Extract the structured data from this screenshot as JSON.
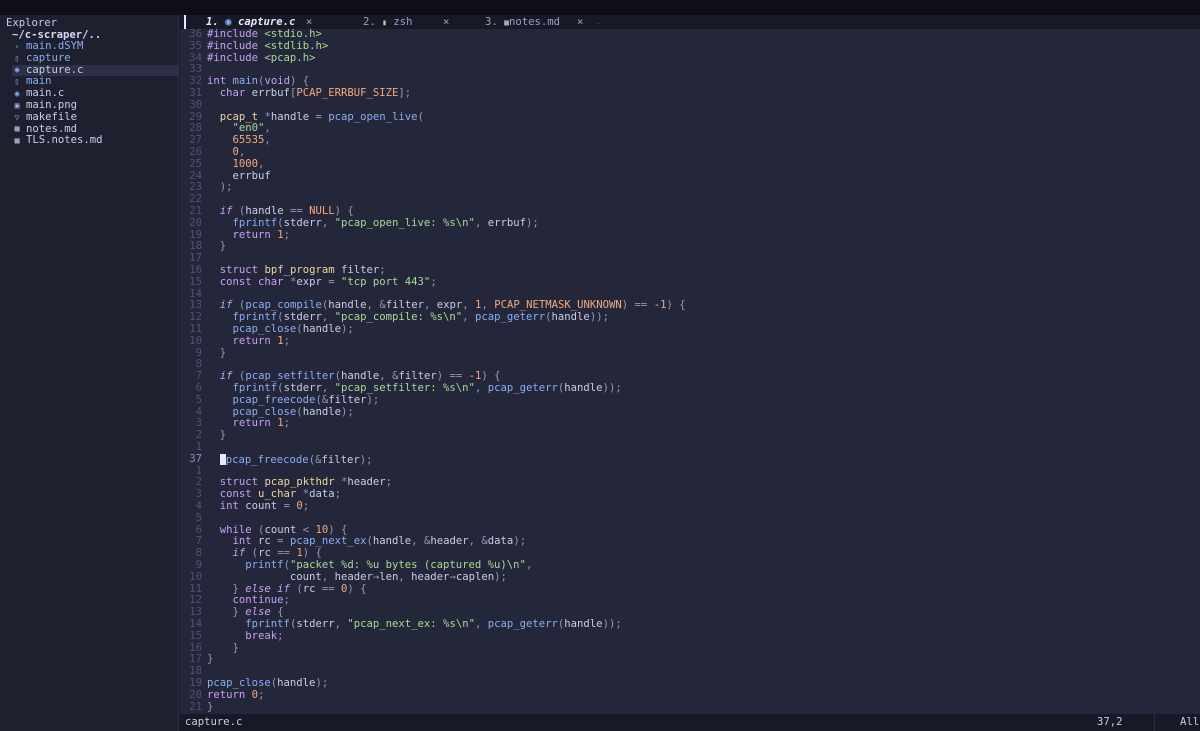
{
  "sidebar": {
    "title": "Explorer",
    "root": "~/c-scraper/..",
    "items": [
      {
        "name": "main.dSYM",
        "icon": "folder-chevron-icon",
        "kind": "dir",
        "selected": false
      },
      {
        "name": "capture",
        "icon": "file-icon",
        "kind": "exe",
        "selected": false
      },
      {
        "name": "capture.c",
        "icon": "c-file-icon",
        "kind": "file",
        "selected": true
      },
      {
        "name": "main",
        "icon": "file-icon",
        "kind": "exe",
        "selected": false
      },
      {
        "name": "main.c",
        "icon": "c-file-icon",
        "kind": "file",
        "selected": false
      },
      {
        "name": "main.png",
        "icon": "image-file-icon",
        "kind": "file",
        "selected": false
      },
      {
        "name": "makefile",
        "icon": "makefile-icon",
        "kind": "file",
        "selected": false
      },
      {
        "name": "notes.md",
        "icon": "markdown-file-icon",
        "kind": "file",
        "selected": false
      },
      {
        "name": "TLS.notes.md",
        "icon": "markdown-file-icon",
        "kind": "file",
        "selected": false
      }
    ]
  },
  "tabs": [
    {
      "index": "1.",
      "icon": "c-file-icon",
      "label": "capture.c",
      "close": "×",
      "active": true
    },
    {
      "index": "2.",
      "icon": "terminal-icon",
      "label": "zsh",
      "close": "×",
      "active": false
    },
    {
      "index": "3.",
      "icon": "markdown-file-icon",
      "label": "notes.md",
      "close": "×",
      "active": false
    }
  ],
  "tabs_overflow": "‥",
  "editor": {
    "lines": [
      {
        "ln": "36",
        "html": "<span class=\"k\">#include</span> <span class=\"s\">&lt;stdio.h&gt;</span>"
      },
      {
        "ln": "35",
        "html": "<span class=\"k\">#include</span> <span class=\"s\">&lt;stdlib.h&gt;</span>"
      },
      {
        "ln": "34",
        "html": "<span class=\"k\">#include</span> <span class=\"s\">&lt;pcap.h&gt;</span>"
      },
      {
        "ln": "33",
        "html": ""
      },
      {
        "ln": "32",
        "html": "<span class=\"k\">int</span> <span class=\"f\">main</span><span class=\"p\">(</span><span class=\"k\">void</span><span class=\"p\">) {</span>"
      },
      {
        "ln": "31",
        "html": "  <span class=\"k\">char</span> errbuf<span class=\"p\">[</span><span class=\"n\">PCAP_ERRBUF_SIZE</span><span class=\"p\">];</span>"
      },
      {
        "ln": "30",
        "html": ""
      },
      {
        "ln": "29",
        "html": "  <span class=\"t\">pcap_t</span> <span class=\"p\">*</span>handle <span class=\"p\">=</span> <span class=\"f\">pcap_open_live</span><span class=\"p\">(</span>"
      },
      {
        "ln": "28",
        "html": "    <span class=\"s\">\"en0\"</span><span class=\"p\">,</span>"
      },
      {
        "ln": "27",
        "html": "    <span class=\"n\">65535</span><span class=\"p\">,</span>"
      },
      {
        "ln": "26",
        "html": "    <span class=\"n\">0</span><span class=\"p\">,</span>"
      },
      {
        "ln": "25",
        "html": "    <span class=\"n\">1000</span><span class=\"p\">,</span>"
      },
      {
        "ln": "24",
        "html": "    errbuf"
      },
      {
        "ln": "23",
        "html": "  <span class=\"p\">);</span>"
      },
      {
        "ln": "22",
        "html": ""
      },
      {
        "ln": "21",
        "html": "  <span class=\"ki\">if</span> <span class=\"p\">(</span>handle <span class=\"p\">==</span> <span class=\"n\">NULL</span><span class=\"p\">) {</span>"
      },
      {
        "ln": "20",
        "html": "    <span class=\"f\">fprintf</span><span class=\"p\">(</span>stderr<span class=\"p\">,</span> <span class=\"s\">\"pcap_open_live: %s\\n\"</span><span class=\"p\">,</span> errbuf<span class=\"p\">);</span>"
      },
      {
        "ln": "19",
        "html": "    <span class=\"k\">return</span> <span class=\"n\">1</span><span class=\"p\">;</span>"
      },
      {
        "ln": "18",
        "html": "  <span class=\"p\">}</span>"
      },
      {
        "ln": "17",
        "html": ""
      },
      {
        "ln": "16",
        "html": "  <span class=\"k\">struct</span> <span class=\"t\">bpf_program</span> filter<span class=\"p\">;</span>"
      },
      {
        "ln": "15",
        "html": "  <span class=\"k\">const</span> <span class=\"k\">char</span> <span class=\"p\">*</span>expr <span class=\"p\">=</span> <span class=\"s\">\"tcp port 443\"</span><span class=\"p\">;</span>"
      },
      {
        "ln": "14",
        "html": ""
      },
      {
        "ln": "13",
        "html": "  <span class=\"ki\">if</span> <span class=\"p\">(</span><span class=\"f\">pcap_compile</span><span class=\"p\">(</span>handle<span class=\"p\">,</span> <span class=\"p\">&amp;</span>filter<span class=\"p\">,</span> expr<span class=\"p\">,</span> <span class=\"n\">1</span><span class=\"p\">,</span> <span class=\"n\">PCAP_NETMASK_UNKNOWN</span><span class=\"p\">) ==</span> <span class=\"n\">-1</span><span class=\"p\">) {</span>"
      },
      {
        "ln": "12",
        "html": "    <span class=\"f\">fprintf</span><span class=\"p\">(</span>stderr<span class=\"p\">,</span> <span class=\"s\">\"pcap_compile: %s\\n\"</span><span class=\"p\">,</span> <span class=\"f\">pcap_geterr</span><span class=\"p\">(</span>handle<span class=\"p\">));</span>"
      },
      {
        "ln": "11",
        "html": "    <span class=\"f\">pcap_close</span><span class=\"p\">(</span>handle<span class=\"p\">);</span>"
      },
      {
        "ln": "10",
        "html": "    <span class=\"k\">return</span> <span class=\"n\">1</span><span class=\"p\">;</span>"
      },
      {
        "ln": "9",
        "html": "  <span class=\"p\">}</span>"
      },
      {
        "ln": "8",
        "html": ""
      },
      {
        "ln": "7",
        "html": "  <span class=\"ki\">if</span> <span class=\"p\">(</span><span class=\"f\">pcap_setfilter</span><span class=\"p\">(</span>handle<span class=\"p\">,</span> <span class=\"p\">&amp;</span>filter<span class=\"p\">) ==</span> <span class=\"n\">-1</span><span class=\"p\">) {</span>"
      },
      {
        "ln": "6",
        "html": "    <span class=\"f\">fprintf</span><span class=\"p\">(</span>stderr<span class=\"p\">,</span> <span class=\"s\">\"pcap_setfilter: %s\\n\"</span><span class=\"p\">,</span> <span class=\"f\">pcap_geterr</span><span class=\"p\">(</span>handle<span class=\"p\">));</span>"
      },
      {
        "ln": "5",
        "html": "    <span class=\"f\">pcap_freecode</span><span class=\"p\">(&amp;</span>filter<span class=\"p\">);</span>"
      },
      {
        "ln": "4",
        "html": "    <span class=\"f\">pcap_close</span><span class=\"p\">(</span>handle<span class=\"p\">);</span>"
      },
      {
        "ln": "3",
        "html": "    <span class=\"k\">return</span> <span class=\"n\">1</span><span class=\"p\">;</span>"
      },
      {
        "ln": "2",
        "html": "  <span class=\"p\">}</span>"
      },
      {
        "ln": "1",
        "html": ""
      },
      {
        "ln": "37",
        "html": "  <span class=\"cursor\"></span><span class=\"f\">pcap_freecode</span><span class=\"p\">(&amp;</span>filter<span class=\"p\">);</span>",
        "current": true
      },
      {
        "ln": "1",
        "html": ""
      },
      {
        "ln": "2",
        "html": "  <span class=\"k\">struct</span> <span class=\"t\">pcap_pkthdr</span> <span class=\"p\">*</span>header<span class=\"p\">;</span>"
      },
      {
        "ln": "3",
        "html": "  <span class=\"k\">const</span> <span class=\"t\">u_char</span> <span class=\"p\">*</span>data<span class=\"p\">;</span>"
      },
      {
        "ln": "4",
        "html": "  <span class=\"k\">int</span> count <span class=\"p\">=</span> <span class=\"n\">0</span><span class=\"p\">;</span>"
      },
      {
        "ln": "5",
        "html": ""
      },
      {
        "ln": "6",
        "html": "  <span class=\"k\">while</span> <span class=\"p\">(</span>count <span class=\"p\">&lt;</span> <span class=\"n\">10</span><span class=\"p\">) {</span>"
      },
      {
        "ln": "7",
        "html": "    <span class=\"k\">int</span> rc <span class=\"p\">=</span> <span class=\"f\">pcap_next_ex</span><span class=\"p\">(</span>handle<span class=\"p\">,</span> <span class=\"p\">&amp;</span>header<span class=\"p\">,</span> <span class=\"p\">&amp;</span>data<span class=\"p\">);</span>"
      },
      {
        "ln": "8",
        "html": "    <span class=\"ki\">if</span> <span class=\"p\">(</span>rc <span class=\"p\">==</span> <span class=\"n\">1</span><span class=\"p\">) {</span>"
      },
      {
        "ln": "9",
        "html": "      <span class=\"f\">printf</span><span class=\"p\">(</span><span class=\"s\">\"packet %d: %u bytes (captured %u)\\n\"</span><span class=\"p\">,</span>"
      },
      {
        "ln": "10",
        "html": "             count<span class=\"p\">,</span> header<span class=\"p\">→</span>len<span class=\"p\">,</span> header<span class=\"p\">→</span>caplen<span class=\"p\">);</span>"
      },
      {
        "ln": "11",
        "html": "    <span class=\"p\">}</span> <span class=\"ki\">else if</span> <span class=\"p\">(</span>rc <span class=\"p\">==</span> <span class=\"n\">0</span><span class=\"p\">) {</span>"
      },
      {
        "ln": "12",
        "html": "    <span class=\"k\">continue</span><span class=\"p\">;</span>"
      },
      {
        "ln": "13",
        "html": "    <span class=\"p\">}</span> <span class=\"ki\">else</span> <span class=\"p\">{</span>"
      },
      {
        "ln": "14",
        "html": "      <span class=\"f\">fprintf</span><span class=\"p\">(</span>stderr<span class=\"p\">,</span> <span class=\"s\">\"pcap_next_ex: %s\\n\"</span><span class=\"p\">,</span> <span class=\"f\">pcap_geterr</span><span class=\"p\">(</span>handle<span class=\"p\">));</span>"
      },
      {
        "ln": "15",
        "html": "      <span class=\"k\">break</span><span class=\"p\">;</span>"
      },
      {
        "ln": "16",
        "html": "    <span class=\"p\">}</span>"
      },
      {
        "ln": "17",
        "html": "<span class=\"p\">}</span>"
      },
      {
        "ln": "18",
        "html": ""
      },
      {
        "ln": "19",
        "html": "<span class=\"f\">pcap_close</span><span class=\"p\">(</span>handle<span class=\"p\">);</span>"
      },
      {
        "ln": "20",
        "html": "<span class=\"k\">return</span> <span class=\"n\">0</span><span class=\"p\">;</span>"
      },
      {
        "ln": "21",
        "html": "<span class=\"p\">}</span>"
      }
    ]
  },
  "statusbar": {
    "filename": "capture.c",
    "position": "37,2",
    "scroll": "All"
  },
  "colors": {
    "background": "#24273a",
    "keyword": "#c6a0f6",
    "type": "#eed49f",
    "function": "#8aadf4",
    "string": "#a6da95",
    "number": "#f5a97f"
  }
}
